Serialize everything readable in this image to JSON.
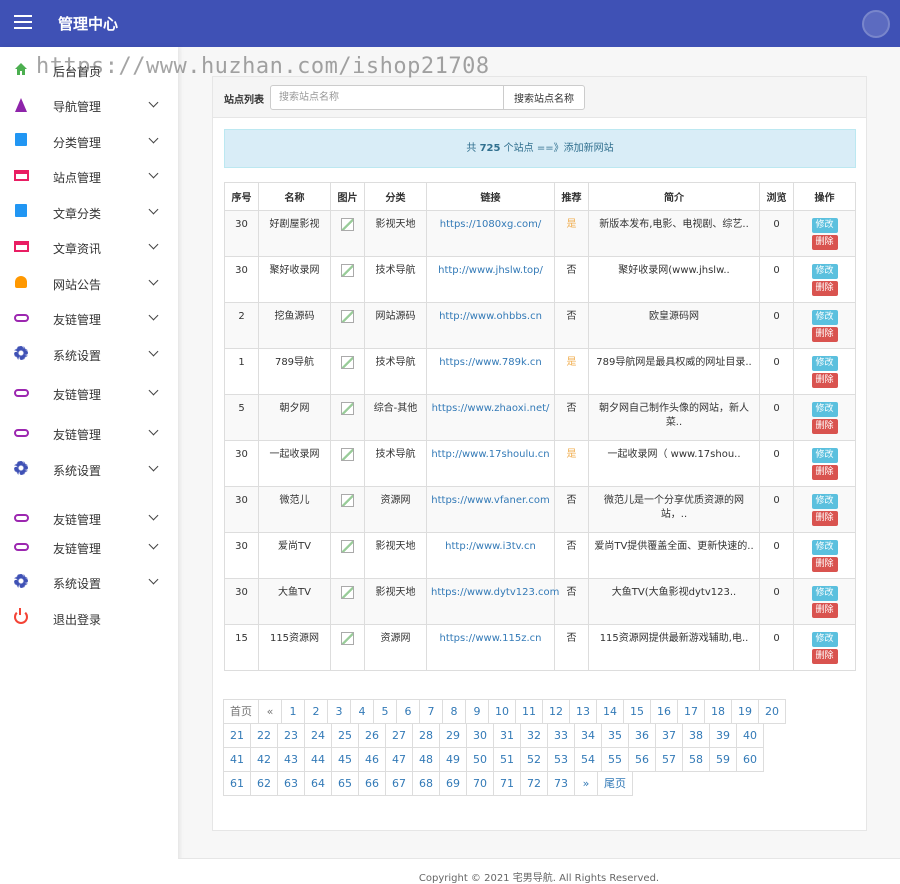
{
  "header": {
    "title": "管理中心"
  },
  "watermark": "https://www.huzhan.com/ishop21708",
  "sidebar": {
    "items": [
      {
        "label": "后台首页",
        "icon": "home-icon",
        "color": "#4caf50",
        "chevron": false
      },
      {
        "label": "导航管理",
        "icon": "navigation-icon",
        "color": "#8e24aa",
        "chevron": true
      },
      {
        "label": "分类管理",
        "icon": "book-icon",
        "color": "#2196f3",
        "chevron": true
      },
      {
        "label": "站点管理",
        "icon": "card-icon",
        "color": "#e91e63",
        "chevron": true
      },
      {
        "label": "文章分类",
        "icon": "book-icon",
        "color": "#2196f3",
        "chevron": true
      },
      {
        "label": "文章资讯",
        "icon": "card-icon",
        "color": "#e91e63",
        "chevron": true
      },
      {
        "label": "网站公告",
        "icon": "bell-icon",
        "color": "#ff9800",
        "chevron": true
      },
      {
        "label": "友链管理",
        "icon": "link-icon",
        "color": "#9c27b0",
        "chevron": true
      },
      {
        "label": "系统设置",
        "icon": "gear-icon",
        "color": "#3f51b5",
        "chevron": true
      },
      {
        "label": "友链管理",
        "icon": "link-icon",
        "color": "#9c27b0",
        "chevron": true
      },
      {
        "label": "友链管理",
        "icon": "link-icon",
        "color": "#9c27b0",
        "chevron": true
      },
      {
        "label": "系统设置",
        "icon": "gear-icon",
        "color": "#3f51b5",
        "chevron": true
      },
      {
        "label": "友链管理",
        "icon": "link-icon",
        "color": "#9c27b0",
        "chevron": true
      },
      {
        "label": "友链管理",
        "icon": "link-icon",
        "color": "#9c27b0",
        "chevron": true
      },
      {
        "label": "系统设置",
        "icon": "gear-icon",
        "color": "#3f51b5",
        "chevron": true
      },
      {
        "label": "退出登录",
        "icon": "power-icon",
        "color": "#f44336",
        "chevron": false
      }
    ]
  },
  "search": {
    "label": "站点列表",
    "placeholder": "搜索站点名称",
    "button": "搜索站点名称"
  },
  "info": {
    "prefix": "共",
    "count": "725",
    "suffix": "个站点 ==》",
    "add_link": "添加新网站"
  },
  "table": {
    "headers": [
      "序号",
      "名称",
      "图片",
      "分类",
      "链接",
      "推荐",
      "简介",
      "浏览",
      "操作"
    ],
    "edit_label": "修改",
    "delete_label": "删除",
    "rows": [
      {
        "order": "30",
        "name": "好剧屋影视",
        "category": "影视天地",
        "link": "https://1080xg.com/",
        "recommend": "是",
        "intro": "新版本发布,电影、电视剧、综艺..",
        "views": "0"
      },
      {
        "order": "30",
        "name": "聚好收录网",
        "category": "技术导航",
        "link": "http://www.jhslw.top/",
        "recommend": "否",
        "intro": "聚好收录网(www.jhslw..",
        "views": "0"
      },
      {
        "order": "2",
        "name": "挖鱼源码",
        "category": "网站源码",
        "link": "http://www.ohbbs.cn",
        "recommend": "否",
        "intro": "欧皇源码网",
        "views": "0"
      },
      {
        "order": "1",
        "name": "789导航",
        "category": "技术导航",
        "link": "https://www.789k.cn",
        "recommend": "是",
        "intro": "789导航网是最具权威的网址目录..",
        "views": "0"
      },
      {
        "order": "5",
        "name": "朝夕网",
        "category": "综合-其他",
        "link": "https://www.zhaoxi.net/",
        "recommend": "否",
        "intro": "朝夕网自己制作头像的网站，新人菜..",
        "views": "0"
      },
      {
        "order": "30",
        "name": "一起收录网",
        "category": "技术导航",
        "link": "http://www.17shoulu.cn",
        "recommend": "是",
        "intro": "一起收录网（ www.17shou..",
        "views": "0"
      },
      {
        "order": "30",
        "name": "微范儿",
        "category": "资源网",
        "link": "https://www.vfaner.com",
        "recommend": "否",
        "intro": "微范儿是一个分享优质资源的网站，..",
        "views": "0"
      },
      {
        "order": "30",
        "name": "爱尚TV",
        "category": "影视天地",
        "link": "http://www.i3tv.cn",
        "recommend": "否",
        "intro": "爱尚TV提供覆盖全面、更新快速的..",
        "views": "0"
      },
      {
        "order": "30",
        "name": "大鱼TV",
        "category": "影视天地",
        "link": "https://www.dytv123.com",
        "recommend": "否",
        "intro": "大鱼TV(大鱼影视dytv123..",
        "views": "0"
      },
      {
        "order": "15",
        "name": "115资源网",
        "category": "资源网",
        "link": "https://www.115z.cn",
        "recommend": "否",
        "intro": "115资源网提供最新游戏辅助,电..",
        "views": "0"
      }
    ]
  },
  "pagination": {
    "first": "首页",
    "prev": "«",
    "next": "»",
    "last": "尾页",
    "rows": [
      [
        "1",
        "2",
        "3",
        "4",
        "5",
        "6",
        "7",
        "8",
        "9",
        "10",
        "11",
        "12",
        "13",
        "14",
        "15",
        "16",
        "17",
        "18",
        "19",
        "20"
      ],
      [
        "21",
        "22",
        "23",
        "24",
        "25",
        "26",
        "27",
        "28",
        "29",
        "30",
        "31",
        "32",
        "33",
        "34",
        "35",
        "36",
        "37",
        "38",
        "39",
        "40"
      ],
      [
        "41",
        "42",
        "43",
        "44",
        "45",
        "46",
        "47",
        "48",
        "49",
        "50",
        "51",
        "52",
        "53",
        "54",
        "55",
        "56",
        "57",
        "58",
        "59",
        "60"
      ],
      [
        "61",
        "62",
        "63",
        "64",
        "65",
        "66",
        "67",
        "68",
        "69",
        "70",
        "71",
        "72",
        "73"
      ]
    ]
  },
  "footer": {
    "text": "Copyright © 2021 宅男导航. All Rights Reserved."
  }
}
